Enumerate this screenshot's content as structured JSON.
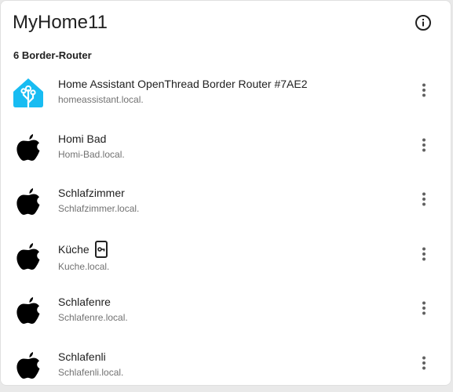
{
  "header": {
    "title": "MyHome11",
    "info_icon": "info-circle-icon"
  },
  "section": {
    "label": "6 Border-Router"
  },
  "routers": [
    {
      "name": "Home Assistant OpenThread Border Router #7AE2",
      "host": "homeassistant.local.",
      "icon": "home-assistant-icon",
      "has_credentials": false
    },
    {
      "name": "Homi Bad",
      "host": "Homi-Bad.local.",
      "icon": "apple-icon",
      "has_credentials": false
    },
    {
      "name": "Schlafzimmer",
      "host": "Schlafzimmer.local.",
      "icon": "apple-icon",
      "has_credentials": false
    },
    {
      "name": "Küche",
      "host": "Kuche.local.",
      "icon": "apple-icon",
      "has_credentials": true
    },
    {
      "name": "Schlafenre",
      "host": "Schlafenre.local.",
      "icon": "apple-icon",
      "has_credentials": false
    },
    {
      "name": "Schlafenli",
      "host": "Schlafenli.local.",
      "icon": "apple-icon",
      "has_credentials": false
    }
  ],
  "colors": {
    "home_assistant_blue": "#18bcf2",
    "text_primary": "#212121",
    "text_secondary": "#727272"
  }
}
